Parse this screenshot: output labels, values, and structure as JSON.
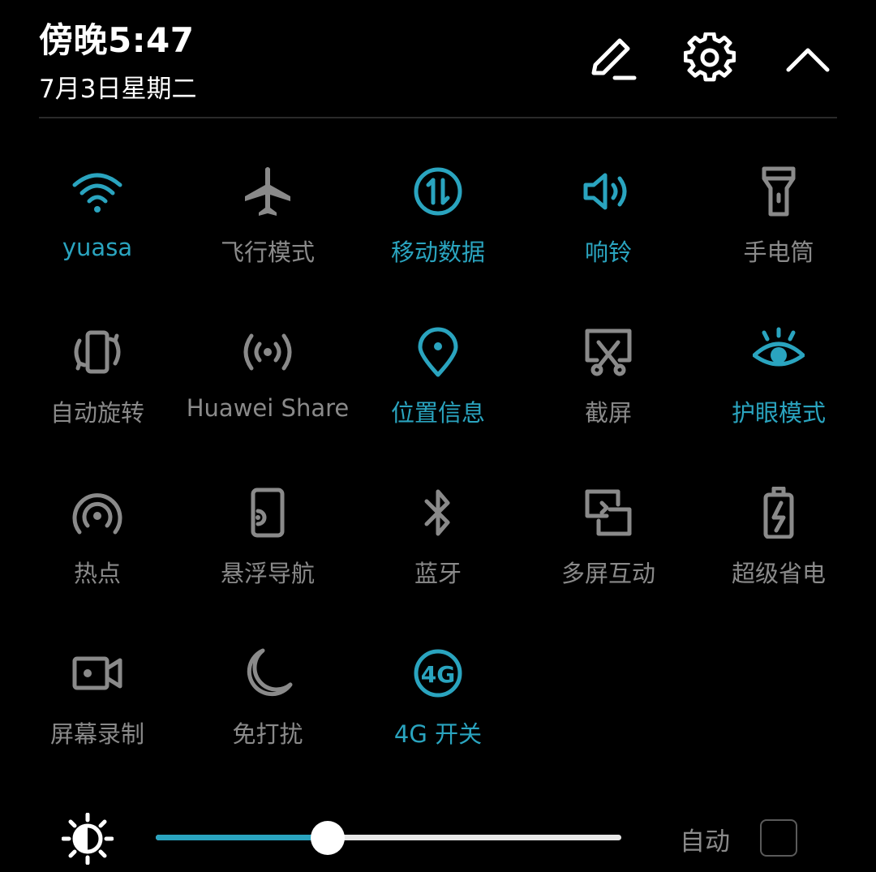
{
  "status": {
    "time": "傍晚5:47",
    "date": "7月3日星期二"
  },
  "header_actions": [
    {
      "name": "edit",
      "icon": "pencil-icon"
    },
    {
      "name": "settings",
      "icon": "gear-icon"
    },
    {
      "name": "collapse",
      "icon": "chevron-up-icon"
    }
  ],
  "tiles": [
    {
      "label": "yuasa",
      "icon": "wifi-icon",
      "active": true
    },
    {
      "label": "飞行模式",
      "icon": "airplane-icon",
      "active": false
    },
    {
      "label": "移动数据",
      "icon": "mobile-data-icon",
      "active": true
    },
    {
      "label": "响铃",
      "icon": "speaker-icon",
      "active": true
    },
    {
      "label": "手电筒",
      "icon": "flashlight-icon",
      "active": false
    },
    {
      "label": "自动旋转",
      "icon": "auto-rotate-icon",
      "active": false
    },
    {
      "label": "Huawei Share",
      "icon": "share-broadcast-icon",
      "active": false
    },
    {
      "label": "位置信息",
      "icon": "location-pin-icon",
      "active": true
    },
    {
      "label": "截屏",
      "icon": "screenshot-icon",
      "active": false
    },
    {
      "label": "护眼模式",
      "icon": "eye-icon",
      "active": true
    },
    {
      "label": "热点",
      "icon": "hotspot-icon",
      "active": false
    },
    {
      "label": "悬浮导航",
      "icon": "floating-nav-icon",
      "active": false
    },
    {
      "label": "蓝牙",
      "icon": "bluetooth-icon",
      "active": false
    },
    {
      "label": "多屏互动",
      "icon": "multi-screen-icon",
      "active": false
    },
    {
      "label": "超级省电",
      "icon": "battery-saver-icon",
      "active": false
    },
    {
      "label": "屏幕录制",
      "icon": "screen-record-icon",
      "active": false
    },
    {
      "label": "免打扰",
      "icon": "moon-icon",
      "active": false
    },
    {
      "label": "4G 开关",
      "icon": "4g-icon",
      "active": true
    }
  ],
  "brightness": {
    "level": 0.37,
    "auto_label": "自动",
    "auto_checked": false
  },
  "colors": {
    "accent": "#2aa4bf",
    "inactive": "#8a8a8a",
    "background": "#000000"
  }
}
